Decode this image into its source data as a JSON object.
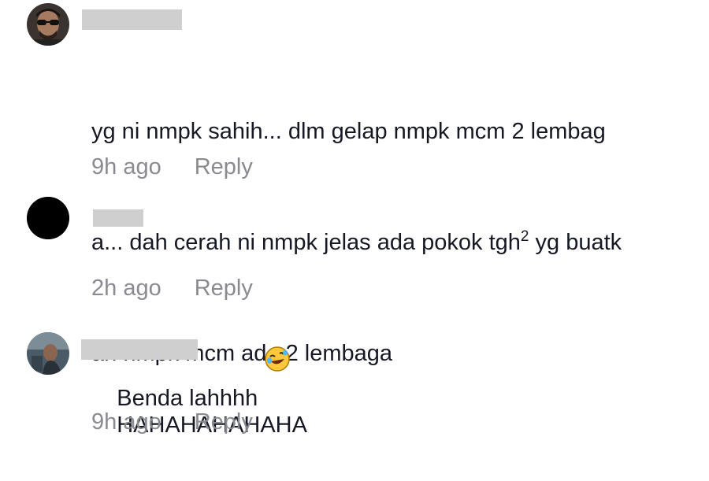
{
  "comments": [
    {
      "avatar": "user-avatar-sunglasses",
      "text_line1": "yg ni nmpk sahih... dlm gelap nmpk mcm 2 lembag",
      "text_line2_pre": "a... dah cerah ni nmpk jelas ada pokok tgh",
      "text_line2_sup": "2",
      "text_line2_post": " yg buatk",
      "text_line3": "an nmpk mcm ada 2 lembaga",
      "time": "9h ago",
      "reply": "Reply"
    },
    {
      "avatar": "user-avatar-black",
      "text": "Benda lahhhh",
      "emoji": "rolling-on-floor-laughing-emoji",
      "time": "2h ago",
      "reply": "Reply"
    },
    {
      "avatar": "user-avatar-photo",
      "text": "HAHAHAHAHAHA",
      "time": "9h ago",
      "reply": "Reply"
    }
  ],
  "colors": {
    "text": "#161823",
    "meta": "#8a8b91",
    "redaction": "#cfcfcf"
  }
}
